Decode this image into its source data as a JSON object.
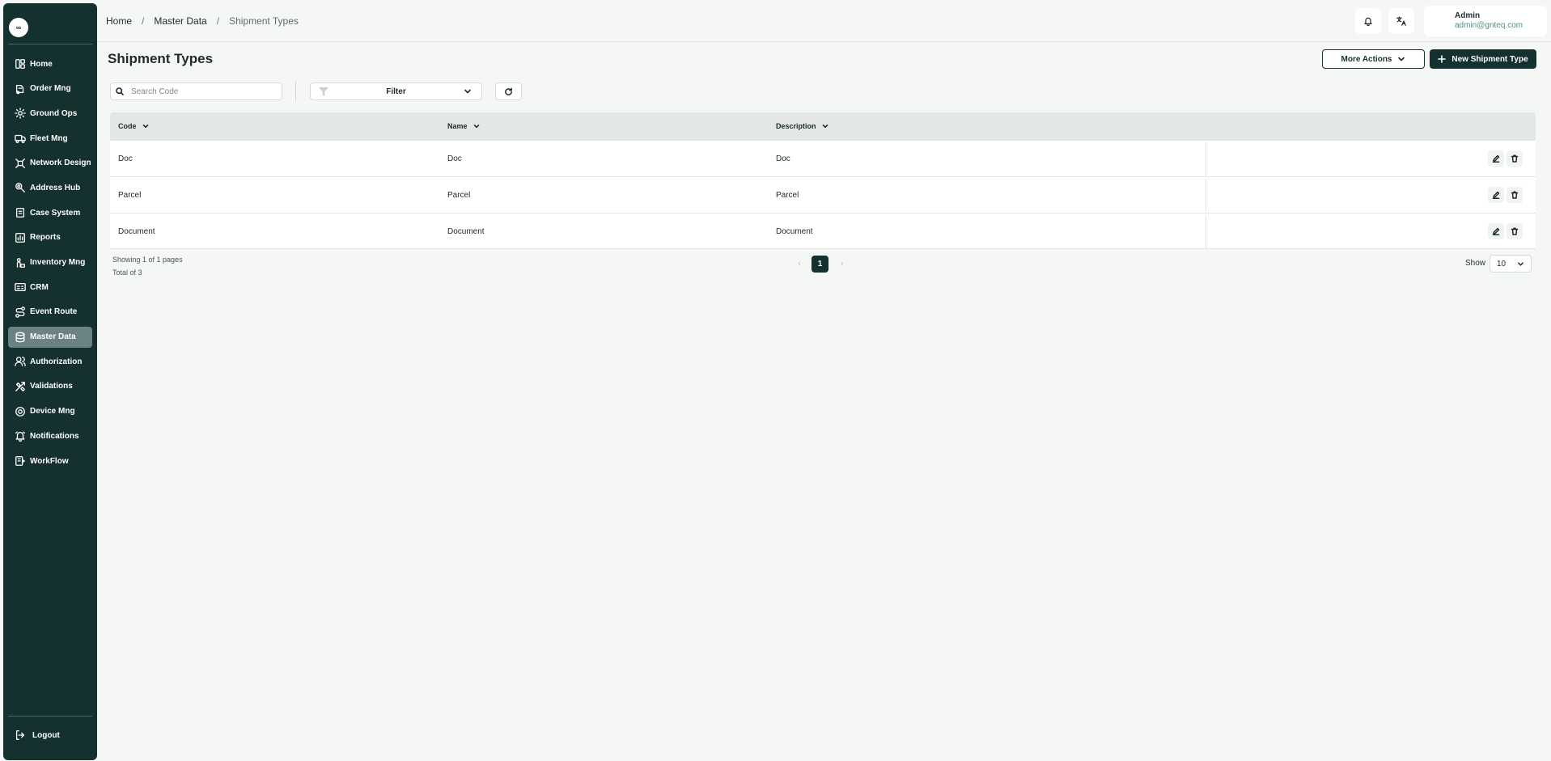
{
  "sidebar": {
    "logo_text": "∞",
    "items": [
      {
        "label": "Home",
        "icon": "dashboard-icon"
      },
      {
        "label": "Order Mng",
        "icon": "order-icon"
      },
      {
        "label": "Ground Ops",
        "icon": "ground-ops-icon"
      },
      {
        "label": "Fleet Mng",
        "icon": "truck-icon"
      },
      {
        "label": "Network Design",
        "icon": "network-icon"
      },
      {
        "label": "Address Hub",
        "icon": "location-icon"
      },
      {
        "label": "Case System",
        "icon": "case-icon"
      },
      {
        "label": "Reports",
        "icon": "report-icon"
      },
      {
        "label": "Inventory Mng",
        "icon": "inventory-icon"
      },
      {
        "label": "CRM",
        "icon": "crm-icon"
      },
      {
        "label": "Event Route",
        "icon": "route-icon"
      },
      {
        "label": "Master Data",
        "icon": "database-icon",
        "active": true
      },
      {
        "label": "Authorization",
        "icon": "users-icon"
      },
      {
        "label": "Validations",
        "icon": "tools-icon"
      },
      {
        "label": "Device Mng",
        "icon": "device-icon"
      },
      {
        "label": "Notifications",
        "icon": "bell-icon"
      },
      {
        "label": "WorkFlow",
        "icon": "workflow-icon"
      }
    ],
    "logout_label": "Logout"
  },
  "breadcrumb": {
    "home": "Home",
    "section": "Master Data",
    "current": "Shipment Types",
    "separator": "/"
  },
  "user": {
    "name": "Admin",
    "email": "admin@gnteq.com"
  },
  "page": {
    "title": "Shipment Types",
    "more_actions_label": "More Actions",
    "new_button_label": "New Shipment Type"
  },
  "toolbar": {
    "search_placeholder": "Search Code",
    "filter_label": "Filter"
  },
  "table": {
    "columns": [
      "Code",
      "Name",
      "Description"
    ],
    "rows": [
      {
        "code": "Doc",
        "name": "Doc",
        "description": "Doc"
      },
      {
        "code": "Parcel",
        "name": "Parcel",
        "description": "Parcel"
      },
      {
        "code": "Document",
        "name": "Document",
        "description": "Document"
      }
    ]
  },
  "pagination": {
    "showing": "Showing 1 of 1 pages",
    "total": "Total of 3",
    "prev": "‹",
    "current_page": "1",
    "next": "›",
    "show_label": "Show",
    "page_size": "10"
  },
  "colors": {
    "sidebar_bg": "#14302f",
    "accent": "#14302f",
    "active_item": "#6b8383",
    "email": "#4f8f8a"
  }
}
